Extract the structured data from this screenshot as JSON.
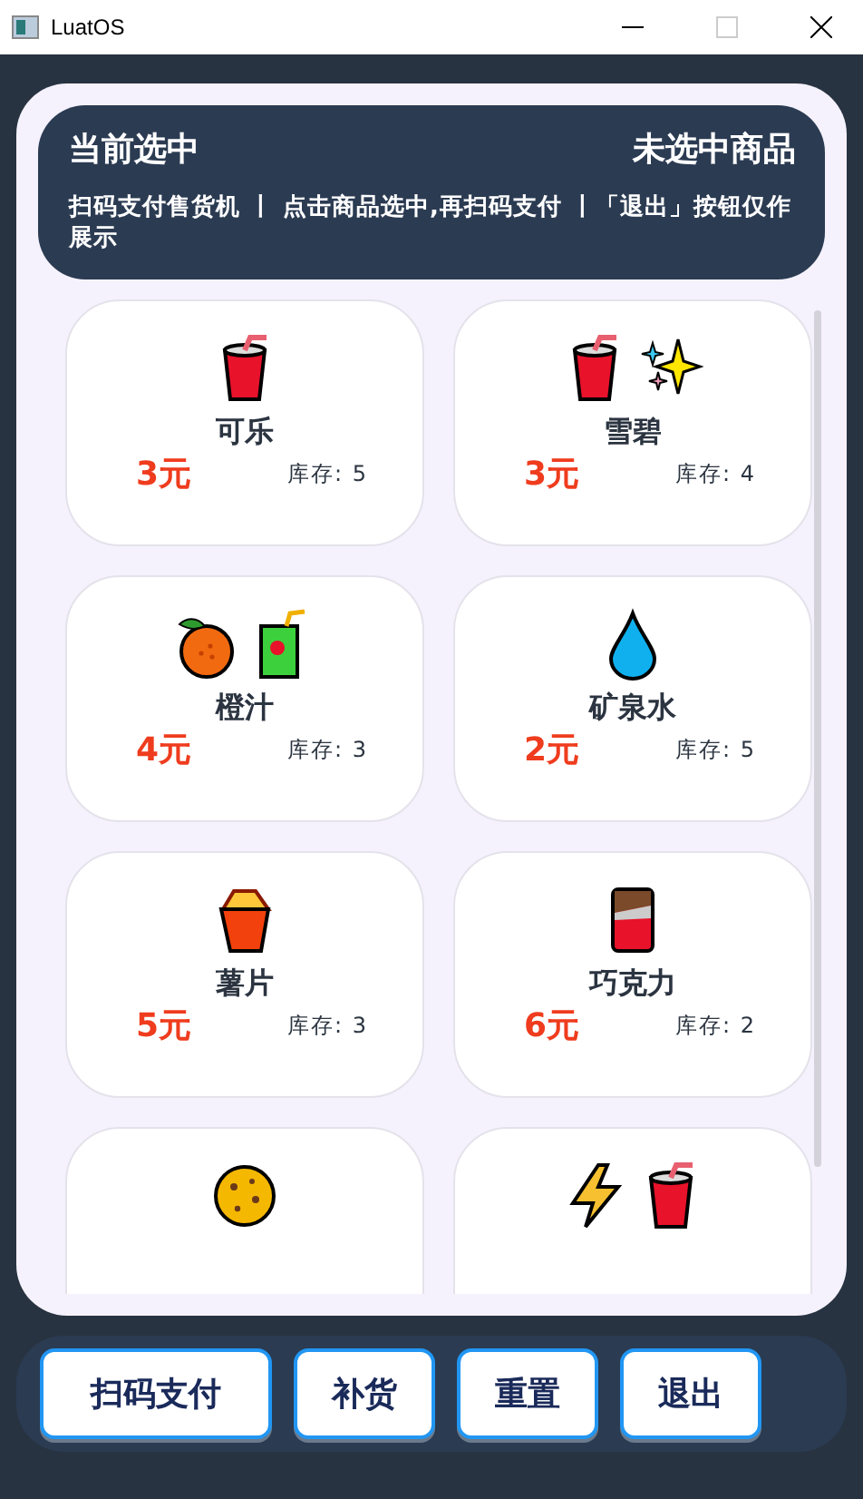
{
  "window": {
    "title": "LuatOS"
  },
  "header": {
    "label": "当前选中",
    "selection": "未选中商品",
    "description": "扫码支付售货机 丨 点击商品选中,再扫码支付 丨「退出」按钮仅作展示"
  },
  "products": [
    {
      "name": "可乐",
      "price": "3元",
      "stock": "库存: 5",
      "icons": [
        {
          "kind": "cup"
        }
      ]
    },
    {
      "name": "雪碧",
      "price": "3元",
      "stock": "库存: 4",
      "icons": [
        {
          "kind": "cup"
        },
        {
          "kind": "sparkles"
        }
      ]
    },
    {
      "name": "橙汁",
      "price": "4元",
      "stock": "库存: 3",
      "icons": [
        {
          "kind": "fruit"
        },
        {
          "kind": "juice"
        }
      ]
    },
    {
      "name": "矿泉水",
      "price": "2元",
      "stock": "库存: 5",
      "icons": [
        {
          "kind": "drop"
        }
      ]
    },
    {
      "name": "薯片",
      "price": "5元",
      "stock": "库存: 3",
      "icons": [
        {
          "kind": "fries"
        }
      ]
    },
    {
      "name": "巧克力",
      "price": "6元",
      "stock": "库存: 2",
      "icons": [
        {
          "kind": "chocolate"
        }
      ]
    },
    {
      "icons": [
        {
          "kind": "cookie"
        }
      ]
    },
    {
      "icons": [
        {
          "kind": "bolt"
        },
        {
          "kind": "cup"
        }
      ]
    }
  ],
  "buttons": [
    "扫码支付",
    "补货",
    "重置",
    "退出"
  ]
}
